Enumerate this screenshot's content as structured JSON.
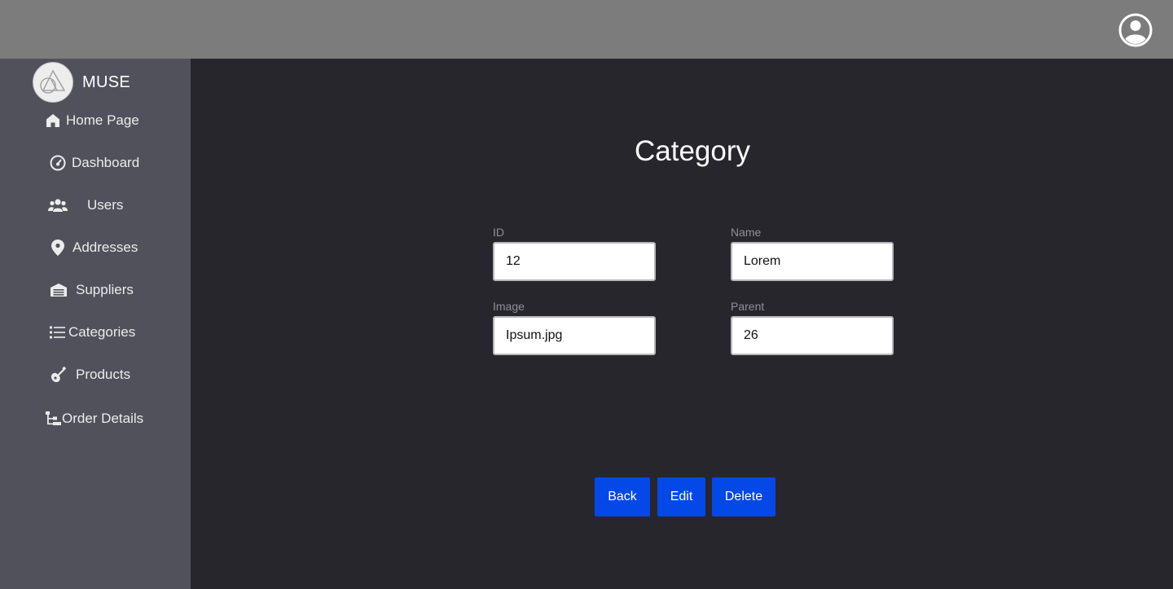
{
  "header": {
    "profile_icon": "account-circle-icon"
  },
  "sidebar": {
    "brand_name": "MUSE",
    "items": [
      {
        "label": "Home Page",
        "icon": "home-icon"
      },
      {
        "label": "Dashboard",
        "icon": "speedometer-icon"
      },
      {
        "label": "Users",
        "icon": "users-icon"
      },
      {
        "label": "Addresses",
        "icon": "map-pin-icon"
      },
      {
        "label": "Suppliers",
        "icon": "warehouse-icon"
      },
      {
        "label": "Categories",
        "icon": "list-icon"
      },
      {
        "label": "Products",
        "icon": "guitar-icon"
      },
      {
        "label": "Order Details",
        "icon": "tree-structure-icon"
      }
    ]
  },
  "main": {
    "title": "Category",
    "fields": [
      {
        "label": "ID",
        "value": "12"
      },
      {
        "label": "Name",
        "value": "Lorem"
      },
      {
        "label": "Image",
        "value": "Ipsum.jpg"
      },
      {
        "label": "Parent",
        "value": "26"
      }
    ],
    "buttons": {
      "back": "Back",
      "edit": "Edit",
      "delete": "Delete"
    }
  },
  "colors": {
    "topbar": "#7c7c7c",
    "sidebar": "#51515b",
    "main_bg": "#27262c",
    "button": "#0548e8"
  }
}
